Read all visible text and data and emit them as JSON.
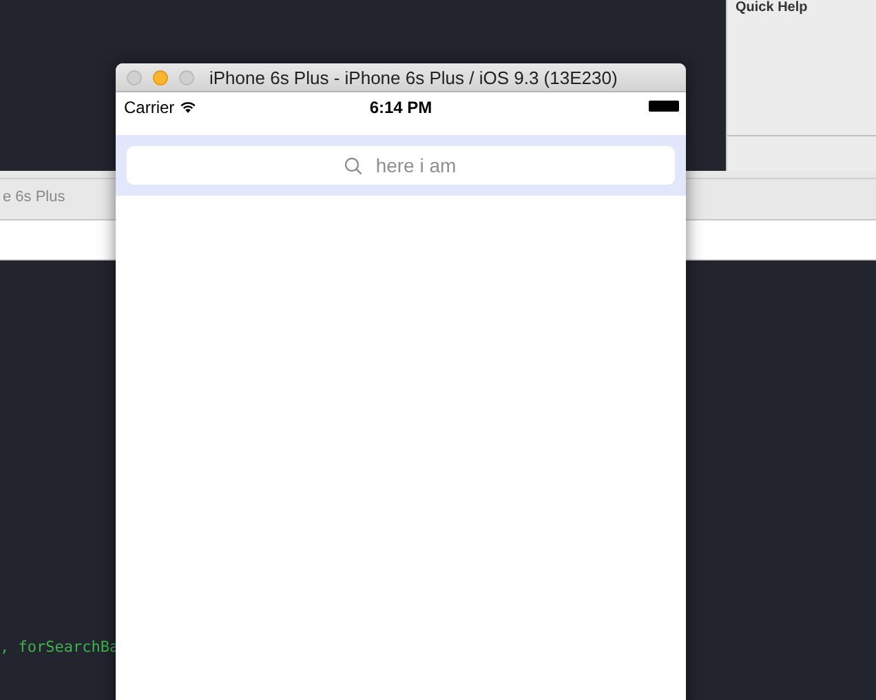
{
  "background_editor": {
    "tab_label": "e 6s Plus",
    "code_line": ", forSearchBa"
  },
  "inspector": {
    "title": "Quick Help"
  },
  "simulator": {
    "window_title": "iPhone 6s Plus - iPhone 6s Plus / iOS 9.3 (13E230)",
    "status_bar": {
      "carrier": "Carrier",
      "time": "6:14 PM"
    },
    "search": {
      "placeholder": "here i am"
    }
  }
}
